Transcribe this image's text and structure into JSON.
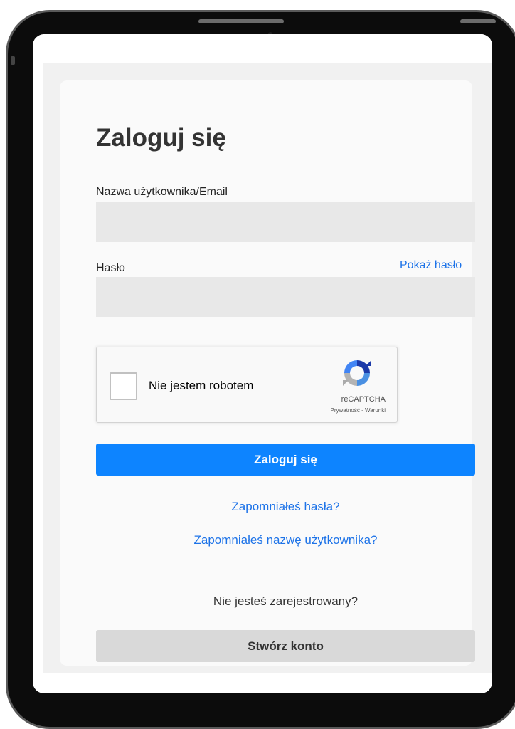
{
  "login": {
    "title": "Zaloguj się",
    "username_label": "Nazwa użytkownika/Email",
    "username_value": "",
    "password_label": "Hasło",
    "password_value": "",
    "show_password": "Pokaż hasło",
    "submit_label": "Zaloguj się",
    "forgot_password": "Zapomniałeś hasła?",
    "forgot_username": "Zapomniałeś nazwę użytkownika?",
    "not_registered": "Nie jesteś zarejestrowany?",
    "create_account": "Stwórz konto"
  },
  "recaptcha": {
    "label": "Nie jestem robotem",
    "brand": "reCAPTCHA",
    "privacy": "Prywatność",
    "separator": " - ",
    "terms": "Warunki",
    "icon": "recaptcha-logo-icon"
  },
  "colors": {
    "primary": "#0d84ff",
    "link": "#1d73e8",
    "secondary_button": "#d9d9d9",
    "field_background": "#e8e8e8"
  }
}
